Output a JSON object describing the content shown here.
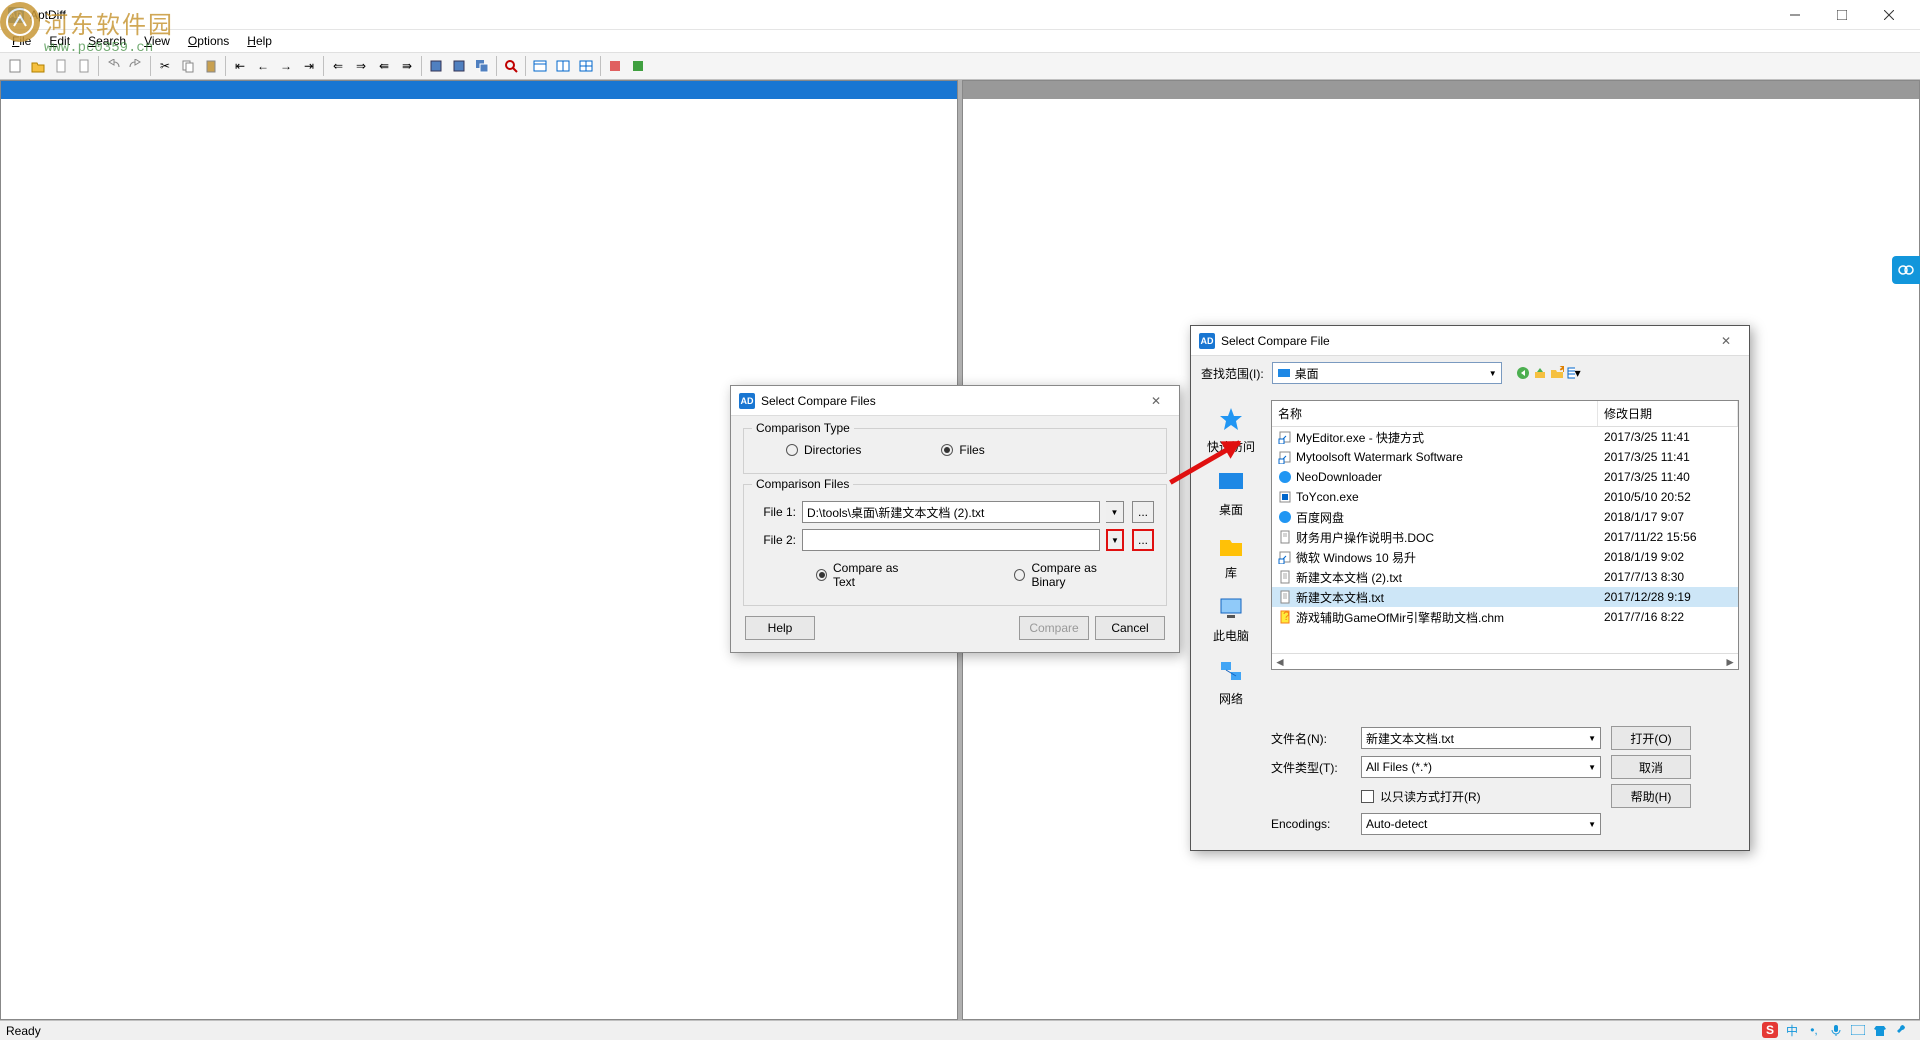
{
  "app": {
    "title": "AptDiff",
    "status": "Ready"
  },
  "watermark": {
    "text": "河东软件园",
    "url": "www.pc0359.cn"
  },
  "menu": {
    "file": "File",
    "edit": "Edit",
    "search": "Search",
    "view": "View",
    "options": "Options",
    "help": "Help"
  },
  "dlg1": {
    "title": "Select Compare Files",
    "group1": "Comparison Type",
    "opt_dir": "Directories",
    "opt_files": "Files",
    "group2": "Comparison Files",
    "file1_label": "File 1:",
    "file1_value": "D:\\tools\\桌面\\新建文本文档 (2).txt",
    "file2_label": "File 2:",
    "file2_value": "",
    "cmp_text": "Compare as Text",
    "cmp_bin": "Compare as Binary",
    "help": "Help",
    "compare": "Compare",
    "cancel": "Cancel"
  },
  "dlg2": {
    "title": "Select Compare File",
    "look_label": "查找范围(I):",
    "look_value": "桌面",
    "nav": {
      "quick": "快速访问",
      "desktop": "桌面",
      "lib": "库",
      "pc": "此电脑",
      "net": "网络"
    },
    "col_name": "名称",
    "col_date": "修改日期",
    "rows": [
      {
        "name": "MyEditor.exe - 快捷方式",
        "date": "2017/3/25 11:41",
        "icon": "shortcut"
      },
      {
        "name": "Mytoolsoft Watermark Software",
        "date": "2017/3/25 11:41",
        "icon": "shortcut"
      },
      {
        "name": "NeoDownloader",
        "date": "2017/3/25 11:40",
        "icon": "app"
      },
      {
        "name": "ToYcon.exe",
        "date": "2010/5/10 20:52",
        "icon": "exe"
      },
      {
        "name": "百度网盘",
        "date": "2018/1/17 9:07",
        "icon": "app"
      },
      {
        "name": "财务用户操作说明书.DOC",
        "date": "2017/11/22 15:56",
        "icon": "doc"
      },
      {
        "name": "微软 Windows 10 易升",
        "date": "2018/1/19 9:02",
        "icon": "shortcut"
      },
      {
        "name": "新建文本文档 (2).txt",
        "date": "2017/7/13 8:30",
        "icon": "txt"
      },
      {
        "name": "新建文本文档.txt",
        "date": "2017/12/28 9:19",
        "icon": "txt",
        "selected": true
      },
      {
        "name": "游戏辅助GameOfMir引擎帮助文档.chm",
        "date": "2017/7/16 8:22",
        "icon": "chm"
      }
    ],
    "fn_label": "文件名(N):",
    "fn_value": "新建文本文档.txt",
    "ft_label": "文件类型(T):",
    "ft_value": "All Files (*.*)",
    "readonly": "以只读方式打开(R)",
    "enc_label": "Encodings:",
    "enc_value": "Auto-detect",
    "open": "打开(O)",
    "cancel": "取消",
    "help": "帮助(H)"
  },
  "ime": {
    "s": "S",
    "lang": "中"
  }
}
